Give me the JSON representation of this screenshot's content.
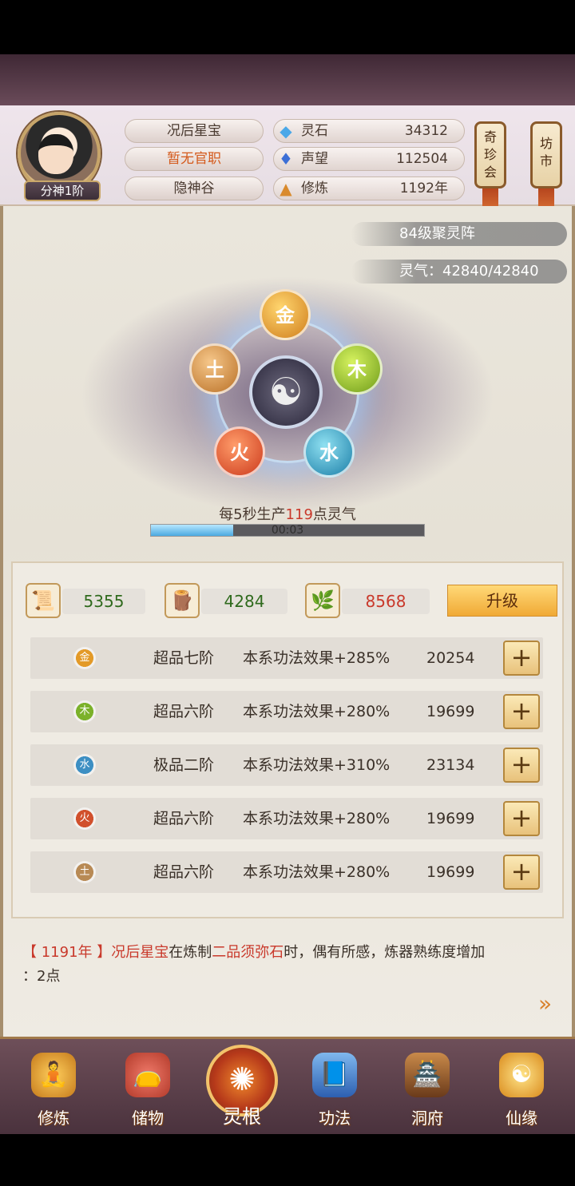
{
  "profile": {
    "rank": "分神1阶",
    "name": "况后星宝",
    "title": "暂无官职",
    "location": "隐神谷"
  },
  "stats": [
    {
      "icon": "spirit-stone-icon",
      "label": "灵石",
      "value": "34312"
    },
    {
      "icon": "reputation-icon",
      "label": "声望",
      "value": "112504"
    },
    {
      "icon": "cultivation-icon",
      "label": "修炼",
      "value": "1192年"
    }
  ],
  "side_buttons": {
    "treasure": "奇珍会",
    "market": "坊市"
  },
  "array": {
    "level_label": "84级聚灵阵",
    "qi_label": "灵气：42840/42840",
    "elements": {
      "jin": "金",
      "mu": "木",
      "shui": "水",
      "huo": "火",
      "tu": "土"
    },
    "production_prefix": "每5秒生产",
    "production_value": "119",
    "production_suffix": "点灵气",
    "timer": "00:03",
    "progress": 0.3
  },
  "resources": [
    {
      "icon": "scroll-icon",
      "value": "5355",
      "color": "#2f6a1d"
    },
    {
      "icon": "wood-icon",
      "value": "4284",
      "color": "#2f6a1d"
    },
    {
      "icon": "herb-icon",
      "value": "8568",
      "color": "#c9392b"
    }
  ],
  "upgrade_label": "升级",
  "roots": [
    {
      "element": "金",
      "color": "#e39a28",
      "grade": "超品七阶",
      "effect": "本系功法效果+285%",
      "amount": "20254"
    },
    {
      "element": "木",
      "color": "#7bb12a",
      "grade": "超品六阶",
      "effect": "本系功法效果+280%",
      "amount": "19699"
    },
    {
      "element": "水",
      "color": "#3d8fc3",
      "grade": "极品二阶",
      "effect": "本系功法效果+310%",
      "amount": "23134"
    },
    {
      "element": "火",
      "color": "#d1502c",
      "grade": "超品六阶",
      "effect": "本系功法效果+280%",
      "amount": "19699"
    },
    {
      "element": "土",
      "color": "#b88a55",
      "grade": "超品六阶",
      "effect": "本系功法效果+280%",
      "amount": "19699"
    }
  ],
  "log": {
    "year": "【 1191年 】",
    "actor": "况后星宝",
    "text1": "在炼制",
    "item": "二品须弥石",
    "text2": "时，偶有所感，炼器熟练度增加",
    "text3": "：2点"
  },
  "nav": {
    "cultivate": "修炼",
    "storage": "储物",
    "spirit_root": "灵根",
    "skills": "功法",
    "cave": "洞府",
    "fate": "仙缘"
  }
}
